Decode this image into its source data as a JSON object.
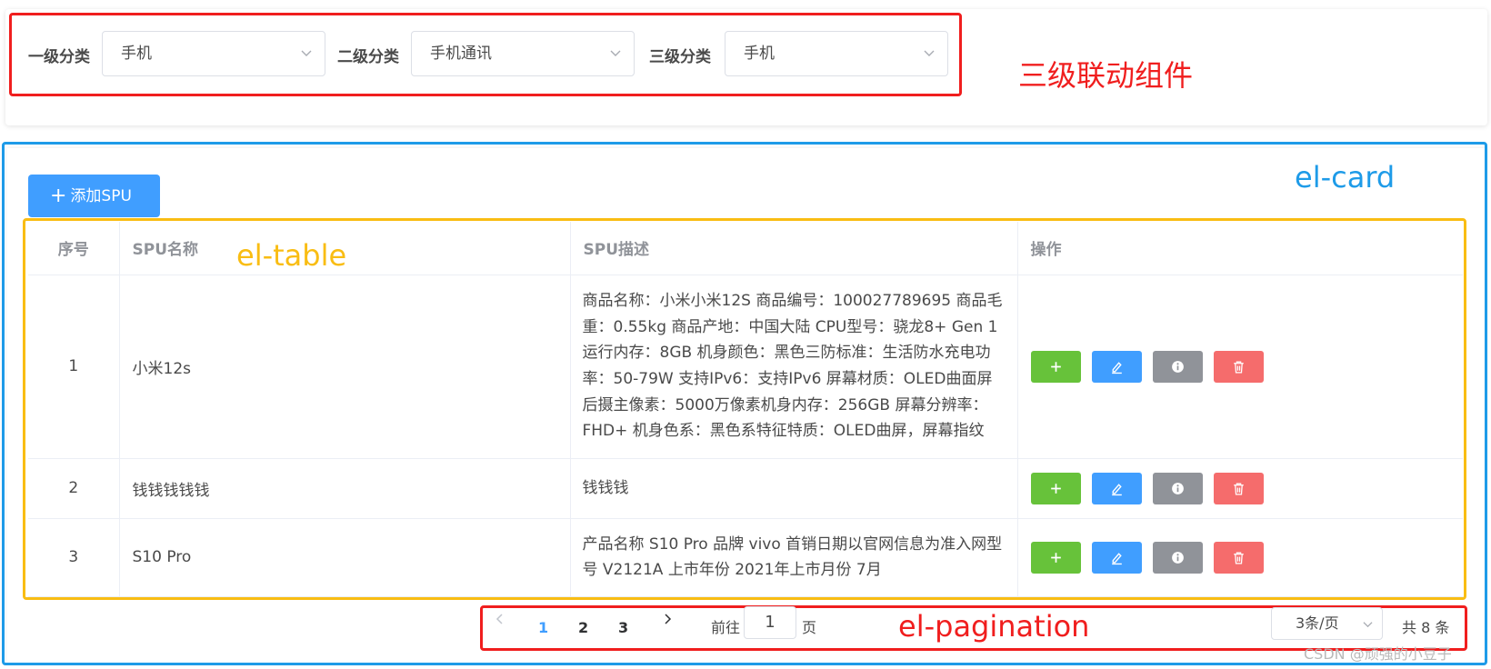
{
  "filters": {
    "level1_label": "一级分类",
    "level1_value": "手机",
    "level2_label": "二级分类",
    "level2_value": "手机通讯",
    "level3_label": "三级分类",
    "level3_value": "手机"
  },
  "annotations": {
    "cascader": "三级联动组件",
    "card": "el-card",
    "table": "el-table",
    "pagination": "el-pagination"
  },
  "toolbar": {
    "add_label": "添加SPU"
  },
  "table": {
    "columns": [
      "序号",
      "SPU名称",
      "SPU描述",
      "操作"
    ],
    "rows": [
      {
        "index": "1",
        "name": "小米12s",
        "desc": "商品名称：小米小米12S 商品编号：100027789695 商品毛重：0.55kg 商品产地：中国大陆 CPU型号：骁龙8+ Gen 1 运行内存：8GB 机身颜色：黑色三防标准：生活防水充电功率：50-79W 支持IPv6：支持IPv6 屏幕材质：OLED曲面屏 后摄主像素：5000万像素机身内存：256GB 屏幕分辨率：FHD+ 机身色系：黑色系特征特质：OLED曲屏，屏幕指纹"
      },
      {
        "index": "2",
        "name": "钱钱钱钱钱",
        "desc": "钱钱钱"
      },
      {
        "index": "3",
        "name": "S10 Pro",
        "desc": "产品名称 S10 Pro 品牌 vivo 首销日期以官网信息为准入网型号 V2121A 上市年份 2021年上市月份 7月"
      }
    ],
    "action_icons": [
      "plus-icon",
      "edit-icon",
      "info-icon",
      "delete-icon"
    ]
  },
  "pagination": {
    "pages": [
      "1",
      "2",
      "3"
    ],
    "current_page": "1",
    "goto_prefix": "前往",
    "goto_value": "1",
    "goto_suffix": "页",
    "page_size": "3条/页",
    "total_text": "共 8 条"
  },
  "watermark": "CSDN @顽强的小豆子",
  "colors": {
    "primary": "#409eff",
    "success": "#67c23a",
    "info": "#909399",
    "danger": "#f56c6c",
    "annotation_red": "#f01e1e",
    "annotation_blue": "#1e9be8",
    "annotation_yellow": "#f9bd13"
  }
}
